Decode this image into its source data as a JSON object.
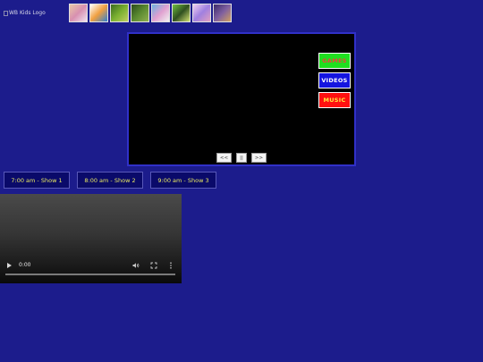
{
  "header": {
    "logo_alt": "WB Kids Logo",
    "thumbnails": [
      {
        "name": "thumbnail-1",
        "colors": [
          "#e8c8a8",
          "#d890b0",
          "#f0e0f0"
        ]
      },
      {
        "name": "thumbnail-2",
        "colors": [
          "#ffffff",
          "#f0a040",
          "#3080d0"
        ]
      },
      {
        "name": "thumbnail-3",
        "colors": [
          "#3a6a20",
          "#7ab030",
          "#c0d060"
        ]
      },
      {
        "name": "thumbnail-4",
        "colors": [
          "#2a4a1a",
          "#5a8a30",
          "#90b050"
        ]
      },
      {
        "name": "thumbnail-5",
        "colors": [
          "#6ab0e0",
          "#e0a0d0",
          "#f0f0f0"
        ]
      },
      {
        "name": "thumbnail-6",
        "colors": [
          "#70c040",
          "#305020",
          "#d0e070"
        ]
      },
      {
        "name": "thumbnail-7",
        "colors": [
          "#f0d0f0",
          "#a080e0",
          "#e0a0c0"
        ]
      },
      {
        "name": "thumbnail-8",
        "colors": [
          "#3a2a6a",
          "#8060a0",
          "#d0a060"
        ]
      }
    ]
  },
  "player": {
    "menu": {
      "games": "GAMES",
      "videos": "VIDEOS",
      "music": "MUSIC"
    },
    "controls": {
      "prev": "<<",
      "pause": "||",
      "next": ">>"
    }
  },
  "shows": [
    {
      "label": "7:00 am - Show 1"
    },
    {
      "label": "8:00 am - Show 2"
    },
    {
      "label": "9:00 am - Show 3"
    }
  ],
  "video": {
    "time": "0:00",
    "progress": 0
  },
  "colors": {
    "background": "#1c1c8c",
    "player_border": "#3030c8",
    "games": "#1fe01f",
    "videos": "#1414e0",
    "music": "#ff1010",
    "show_text": "#e8e860"
  }
}
